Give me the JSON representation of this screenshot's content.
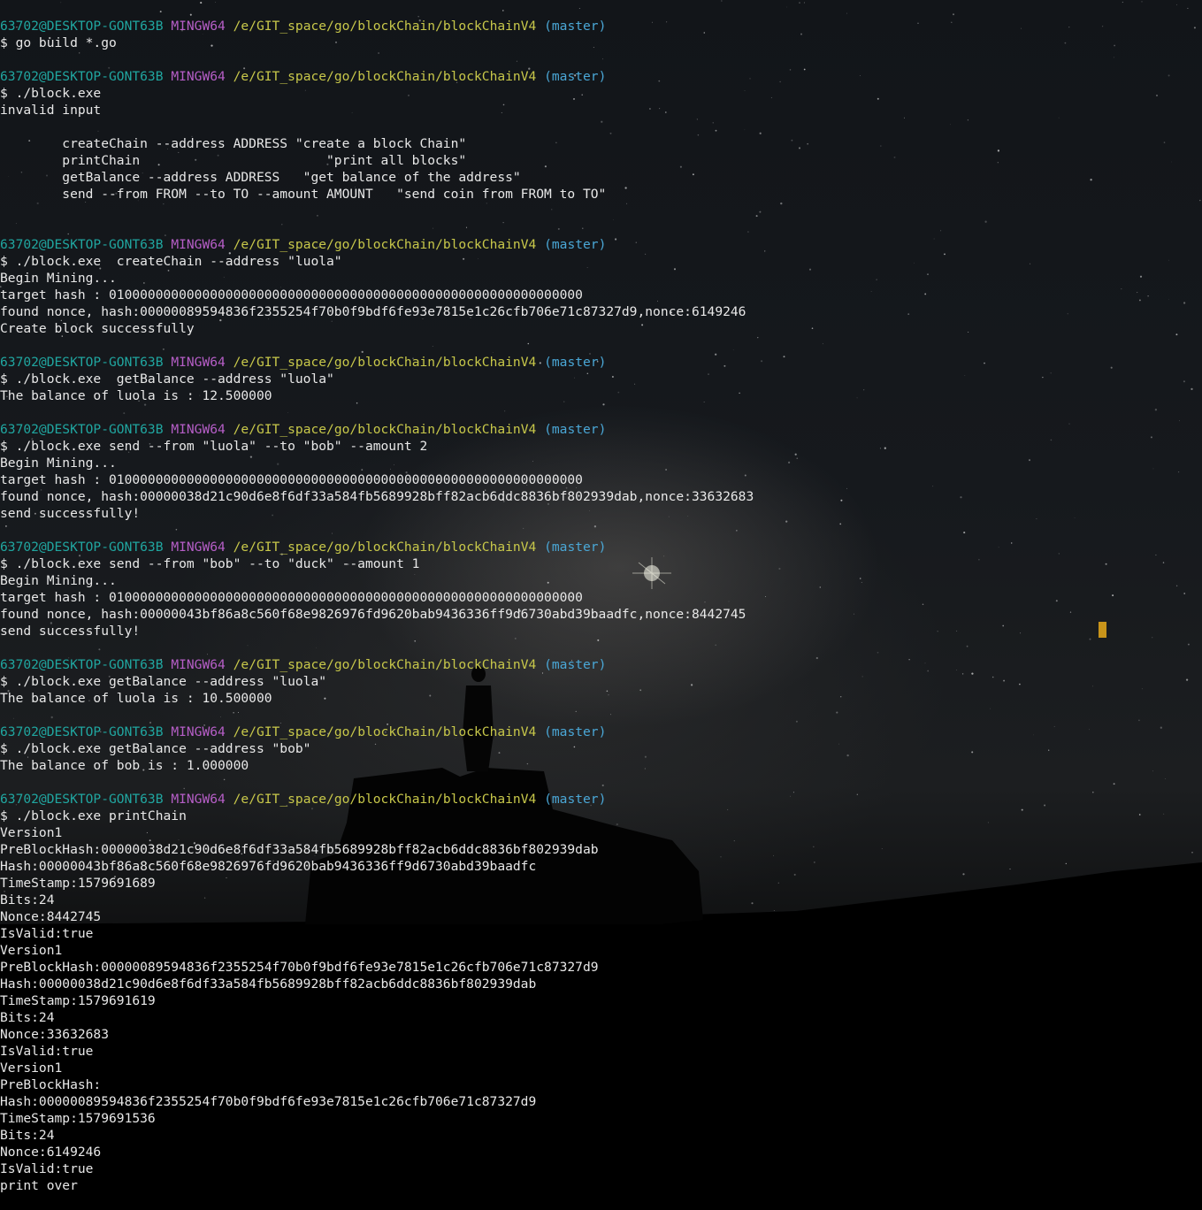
{
  "prompt": {
    "user": "63702@DESKTOP-GONT63B",
    "system": "MINGW64",
    "path": "/e/GIT_space/go/blockChain/blockChainV4",
    "branch": "(master)"
  },
  "colors": {
    "user": "#20a6a0",
    "system": "#b65ec7",
    "path": "#c8c84a",
    "branch": "#4aa7d6",
    "text": "#e8e8e8",
    "cursor": "#c8941a"
  },
  "lines": [
    {
      "type": "prompt"
    },
    {
      "type": "text",
      "text": "$ go build *.go"
    },
    {
      "type": "text",
      "text": ""
    },
    {
      "type": "prompt"
    },
    {
      "type": "text",
      "text": "$ ./block.exe"
    },
    {
      "type": "text",
      "text": "invalid input"
    },
    {
      "type": "text",
      "text": ""
    },
    {
      "type": "text",
      "text": "        createChain --address ADDRESS \"create a block Chain\""
    },
    {
      "type": "text",
      "text": "        printChain                        \"print all blocks\""
    },
    {
      "type": "text",
      "text": "        getBalance --address ADDRESS   \"get balance of the address\""
    },
    {
      "type": "text",
      "text": "        send --from FROM --to TO --amount AMOUNT   \"send coin from FROM to TO\""
    },
    {
      "type": "text",
      "text": ""
    },
    {
      "type": "text",
      "text": ""
    },
    {
      "type": "prompt"
    },
    {
      "type": "text",
      "text": "$ ./block.exe  createChain --address \"luola\""
    },
    {
      "type": "text",
      "text": "Begin Mining..."
    },
    {
      "type": "text",
      "text": "target hash : 0100000000000000000000000000000000000000000000000000000000000"
    },
    {
      "type": "text",
      "text": "found nonce, hash:00000089594836f2355254f70b0f9bdf6fe93e7815e1c26cfb706e71c87327d9,nonce:6149246"
    },
    {
      "type": "text",
      "text": "Create block successfully"
    },
    {
      "type": "text",
      "text": ""
    },
    {
      "type": "prompt"
    },
    {
      "type": "text",
      "text": "$ ./block.exe  getBalance --address \"luola\""
    },
    {
      "type": "text",
      "text": "The balance of luola is : 12.500000"
    },
    {
      "type": "text",
      "text": ""
    },
    {
      "type": "prompt"
    },
    {
      "type": "text",
      "text": "$ ./block.exe send --from \"luola\" --to \"bob\" --amount 2"
    },
    {
      "type": "text",
      "text": "Begin Mining..."
    },
    {
      "type": "text",
      "text": "target hash : 0100000000000000000000000000000000000000000000000000000000000"
    },
    {
      "type": "text",
      "text": "found nonce, hash:00000038d21c90d6e8f6df33a584fb5689928bff82acb6ddc8836bf802939dab,nonce:33632683"
    },
    {
      "type": "text",
      "text": "send successfully!"
    },
    {
      "type": "text",
      "text": ""
    },
    {
      "type": "prompt"
    },
    {
      "type": "text",
      "text": "$ ./block.exe send --from \"bob\" --to \"duck\" --amount 1"
    },
    {
      "type": "text",
      "text": "Begin Mining..."
    },
    {
      "type": "text",
      "text": "target hash : 0100000000000000000000000000000000000000000000000000000000000"
    },
    {
      "type": "text",
      "text": "found nonce, hash:00000043bf86a8c560f68e9826976fd9620bab9436336ff9d6730abd39baadfc,nonce:8442745"
    },
    {
      "type": "text",
      "text": "send successfully!"
    },
    {
      "type": "text",
      "text": ""
    },
    {
      "type": "prompt"
    },
    {
      "type": "text",
      "text": "$ ./block.exe getBalance --address \"luola\""
    },
    {
      "type": "text",
      "text": "The balance of luola is : 10.500000"
    },
    {
      "type": "text",
      "text": ""
    },
    {
      "type": "prompt"
    },
    {
      "type": "text",
      "text": "$ ./block.exe getBalance --address \"bob\""
    },
    {
      "type": "text",
      "text": "The balance of bob is : 1.000000"
    },
    {
      "type": "text",
      "text": ""
    },
    {
      "type": "prompt"
    },
    {
      "type": "text",
      "text": "$ ./block.exe printChain"
    },
    {
      "type": "text",
      "text": "Version1"
    },
    {
      "type": "text",
      "text": "PreBlockHash:00000038d21c90d6e8f6df33a584fb5689928bff82acb6ddc8836bf802939dab"
    },
    {
      "type": "text",
      "text": "Hash:00000043bf86a8c560f68e9826976fd9620bab9436336ff9d6730abd39baadfc"
    },
    {
      "type": "text",
      "text": "TimeStamp:1579691689"
    },
    {
      "type": "text",
      "text": "Bits:24"
    },
    {
      "type": "text",
      "text": "Nonce:8442745"
    },
    {
      "type": "text",
      "text": "IsValid:true"
    },
    {
      "type": "text",
      "text": "Version1"
    },
    {
      "type": "text",
      "text": "PreBlockHash:00000089594836f2355254f70b0f9bdf6fe93e7815e1c26cfb706e71c87327d9"
    },
    {
      "type": "text",
      "text": "Hash:00000038d21c90d6e8f6df33a584fb5689928bff82acb6ddc8836bf802939dab"
    },
    {
      "type": "text",
      "text": "TimeStamp:1579691619"
    },
    {
      "type": "text",
      "text": "Bits:24"
    },
    {
      "type": "text",
      "text": "Nonce:33632683"
    },
    {
      "type": "text",
      "text": "IsValid:true"
    },
    {
      "type": "text",
      "text": "Version1"
    },
    {
      "type": "text",
      "text": "PreBlockHash:"
    },
    {
      "type": "text",
      "text": "Hash:00000089594836f2355254f70b0f9bdf6fe93e7815e1c26cfb706e71c87327d9"
    },
    {
      "type": "text",
      "text": "TimeStamp:1579691536"
    },
    {
      "type": "text",
      "text": "Bits:24"
    },
    {
      "type": "text",
      "text": "Nonce:6149246"
    },
    {
      "type": "text",
      "text": "IsValid:true"
    },
    {
      "type": "text",
      "text": "print over"
    }
  ]
}
